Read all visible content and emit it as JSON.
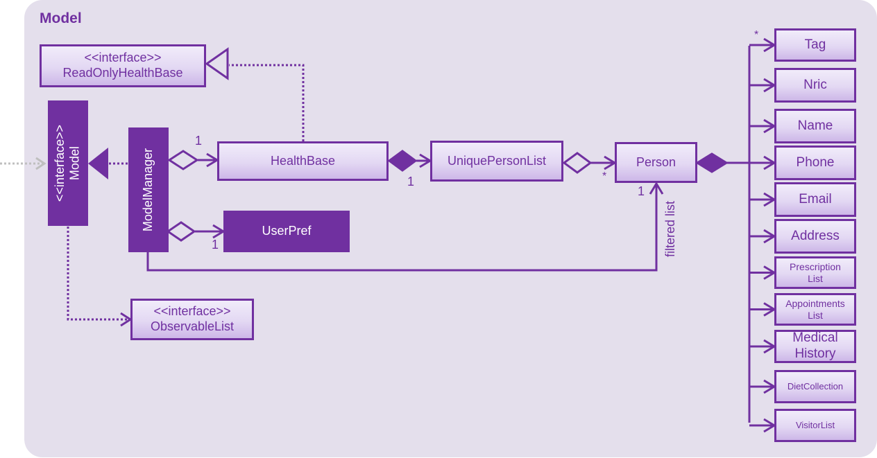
{
  "package": {
    "title": "Model"
  },
  "classes": {
    "readOnlyHealthBase": {
      "stereotype": "<<interface>>",
      "name": "ReadOnlyHealthBase"
    },
    "model": {
      "stereotype": "<<interface>>",
      "name": "Model"
    },
    "modelManager": {
      "name": "ModelManager"
    },
    "healthBase": {
      "name": "HealthBase"
    },
    "uniquePersonList": {
      "name": "UniquePersonList"
    },
    "person": {
      "name": "Person"
    },
    "userPref": {
      "name": "UserPref"
    },
    "observableList": {
      "stereotype": "<<interface>>",
      "name": "ObservableList"
    },
    "attributes": [
      {
        "line1": "Tag",
        "line2": ""
      },
      {
        "line1": "Nric",
        "line2": ""
      },
      {
        "line1": "Name",
        "line2": ""
      },
      {
        "line1": "Phone",
        "line2": ""
      },
      {
        "line1": "Email",
        "line2": ""
      },
      {
        "line1": "Address",
        "line2": ""
      },
      {
        "line1": "Prescription",
        "line2": "List"
      },
      {
        "line1": "Appointments",
        "line2": "List"
      },
      {
        "line1": "Medical",
        "line2": "History"
      },
      {
        "line1": "DietCollection",
        "line2": ""
      },
      {
        "line1": "VisitorList",
        "line2": ""
      }
    ]
  },
  "multiplicities": {
    "modelManager_healthBase": "1",
    "healthBase_uniquePersonList": "1",
    "uniquePersonList_person": "*",
    "modelManager_userPref": "1",
    "filteredList_person": "1",
    "person_tag": "*"
  },
  "association_labels": {
    "filtered_list": "filtered list"
  },
  "colors": {
    "accent": "#7030a0",
    "panel": "#e4dfec",
    "external_arrow": "#bfbfbf"
  }
}
